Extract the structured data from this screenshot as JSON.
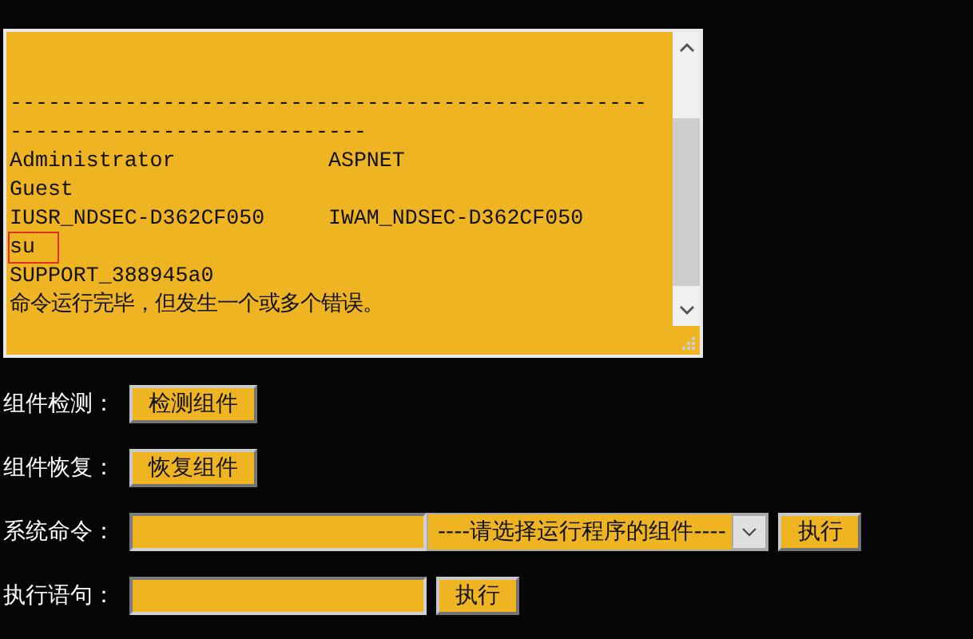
{
  "output": {
    "lines": [
      {
        "text": "--------------------------------------------------",
        "highlighted": false
      },
      {
        "text": "----------------------------",
        "highlighted": false
      },
      {
        "text": "Administrator            ASPNET",
        "highlighted": false
      },
      {
        "text": "Guest",
        "highlighted": false
      },
      {
        "text": "IUSR_NDSEC-D362CF050     IWAM_NDSEC-D362CF050",
        "highlighted": false
      },
      {
        "text": "su",
        "highlighted": true
      },
      {
        "text": "SUPPORT_388945a0",
        "highlighted": false
      },
      {
        "text": "命令运行完毕，但发生一个或多个错误。",
        "highlighted": false
      }
    ]
  },
  "rows": [
    {
      "label": "组件检测：",
      "kind": "button",
      "button": "检测组件"
    },
    {
      "label": "组件恢复：",
      "kind": "button",
      "button": "恢复组件"
    },
    {
      "label": "系统命令：",
      "kind": "command",
      "select": "----请选择运行程序的组件----",
      "button": "执行"
    },
    {
      "label": "执行语句：",
      "kind": "input",
      "button": "执行"
    }
  ]
}
